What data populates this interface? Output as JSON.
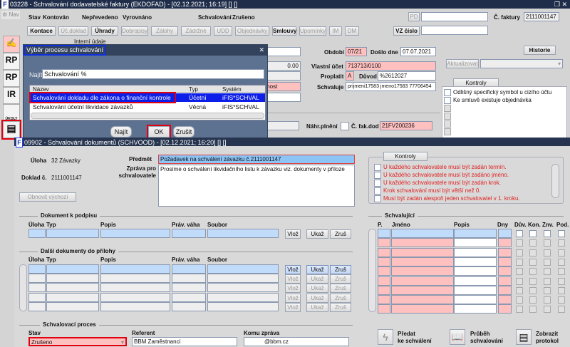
{
  "back": {
    "title": "03228 - Schvalování dodavatelské faktury (EKDOFAD) - [02.12.2021; 16:19] [] []",
    "nav": "Nav",
    "status": {
      "stav_label": "Stav",
      "stav": "Kontován",
      "s2": "Nepřevedeno",
      "s3": "Vyrovnáno",
      "schval_label": "Schvalování",
      "schval": "Zrušeno"
    },
    "tabs": [
      "Kontace",
      "Úč.doklad",
      "Úhrady",
      "Dobropisy",
      "Zálohy",
      "Zádržné",
      "UDD",
      "Objednávky",
      "Smlouvy",
      "Upomínky",
      "IM",
      "DM"
    ],
    "pd_label": "PD",
    "vz_label": "VZ číslo",
    "faktura_label": "Č. faktury",
    "faktura": "2111001147",
    "interni": "Interní údaje",
    "left_values": [
      "0.00",
      "innost"
    ],
    "obdobi_label": "Období",
    "obdobi": "07/21",
    "doslo_label": "Došlo dne",
    "doslo": "07.07.2021",
    "ucet_label": "Vlastní účet",
    "ucet": "713713/0100",
    "proplatit_label": "Proplatit",
    "proplatit": "A",
    "duvod_label": "Důvod",
    "duvod": "%2612027",
    "schvaluje_label": "Schvaluje",
    "schvaluje": "prijmeni17583 jmeno17583 77706454",
    "historie": "Historie",
    "aktualizovat": "Aktualizovat",
    "kontroly_tab": "Kontroly",
    "kontroly": [
      "Odlišný specifický symbol u cizího účtu",
      "Ke smluvě existuje objednávka"
    ],
    "nahr_label": "Náhr.plnění",
    "fakdod_label": "Č. fak.dod",
    "fakdod": "21FV200236",
    "sidebar": [
      "RP",
      "RP",
      "IR",
      "ÚKOLY"
    ]
  },
  "dialog": {
    "title": "Výběr procesu schvalování",
    "najit_label": "Najít",
    "najit_value": "Schvalování %",
    "columns": [
      "Název",
      "Typ",
      "Systém"
    ],
    "rows": [
      [
        "Schvalování dokladu dle zákona o finanční kontrole",
        "Účetní",
        "iFIS*SCHVAL"
      ],
      [
        "Schvalování účetní likvidace závazků",
        "Věcná",
        "iFIS*SCHVAL"
      ]
    ],
    "buttons": {
      "najit": "Najít",
      "ok": "OK",
      "zrusit": "Zrušit"
    }
  },
  "front": {
    "title": "09902 - Schvalování dokumentů (SCHVOOD) - [02.12.2021; 16:20] [] []",
    "uloha_label": "Úloha",
    "uloha": "32 Závazky",
    "doklad_label": "Doklad č.",
    "doklad": "2111001147",
    "predmet_label": "Předmět",
    "predmet": "Požadavek na schválení závazku č.2111001147",
    "zprava_label": "Zpráva pro schvalovatele",
    "zprava": "Prosíme o schválení likvidačního listu k závazku viz. dokumenty v příloze",
    "obnovit": "Obnovit výchozí",
    "kontroly_tab": "Kontroly",
    "kontroly": [
      "U každého schvalovatele musí být zadán termín.",
      "U každého schvalovatele musí být zadáno jméno.",
      "U každého schvalovatele musí být zadán krok.",
      "Krok schvalování musí být větší než 0.",
      "Musí být zadán alespoň jeden schvalovatel v 1. kroku."
    ],
    "doc_title": "Dokument k podpisu",
    "doc_cols": [
      "Úloha",
      "Typ",
      "Popis",
      "Práv. váha",
      "Soubor"
    ],
    "other_title": "Další dokumenty do přílohy",
    "row_buttons": {
      "vloz": "Vlož",
      "ukaz": "Ukaž",
      "zrus": "Zruš"
    },
    "schval_title": "Schvalující",
    "schval_cols": [
      "P.",
      "Jméno",
      "Popis",
      "Dny",
      "Dův.",
      "Kon.",
      "Znv.",
      "Pod."
    ],
    "proc_title": "Schvalovací proces",
    "stav_label": "Stav",
    "stav": "Zrušeno",
    "referent_label": "Referent",
    "referent": "BBM Zaměstnanci",
    "komu_label": "Komu zpráva",
    "komu": "@bbm.cz",
    "actions": {
      "predat1": "Předat",
      "predat2": "ke schválení",
      "prubeh1": "Průběh",
      "prubeh2": "schvalování",
      "zobrazit1": "Zobrazit",
      "zobrazit2": "protokol"
    }
  }
}
